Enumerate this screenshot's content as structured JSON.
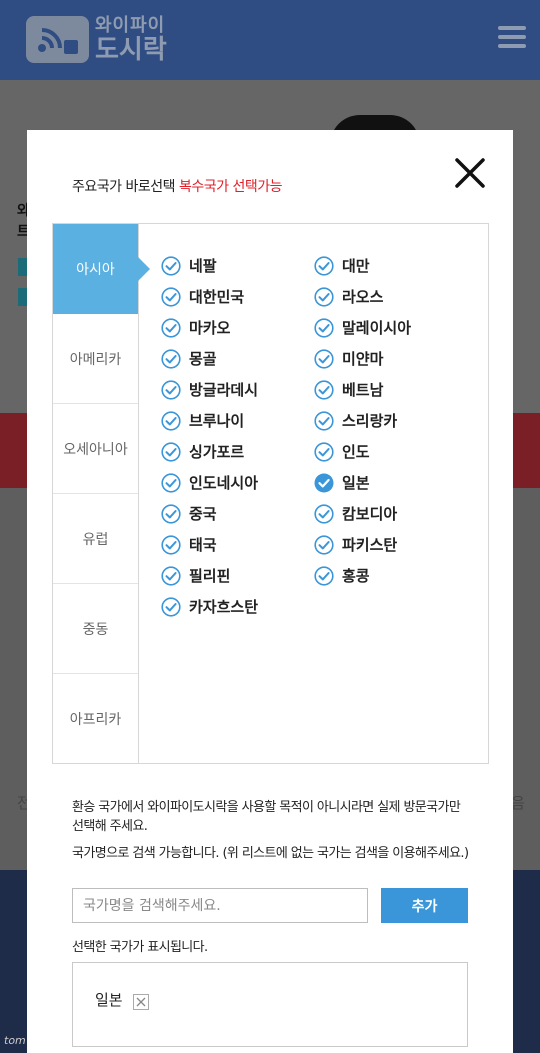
{
  "header": {
    "logo_line1": "와이파이",
    "logo_line2": "도시락"
  },
  "background": {
    "frag1": "와",
    "frag2": "트",
    "frag3": "전",
    "frag4": "음"
  },
  "watermark": "tom",
  "modal": {
    "title": "주요국가 바로선택",
    "title_note": "복수국가 선택가능",
    "tabs": [
      "아시아",
      "아메리카",
      "오세아니아",
      "유럽",
      "중동",
      "아프리카"
    ],
    "active_tab": "아시아",
    "countries": [
      {
        "name": "네팔",
        "checked": false
      },
      {
        "name": "대만",
        "checked": false
      },
      {
        "name": "대한민국",
        "checked": false
      },
      {
        "name": "라오스",
        "checked": false
      },
      {
        "name": "마카오",
        "checked": false
      },
      {
        "name": "말레이시아",
        "checked": false
      },
      {
        "name": "몽골",
        "checked": false
      },
      {
        "name": "미얀마",
        "checked": false
      },
      {
        "name": "방글라데시",
        "checked": false
      },
      {
        "name": "베트남",
        "checked": false
      },
      {
        "name": "브루나이",
        "checked": false
      },
      {
        "name": "스리랑카",
        "checked": false
      },
      {
        "name": "싱가포르",
        "checked": false
      },
      {
        "name": "인도",
        "checked": false
      },
      {
        "name": "인도네시아",
        "checked": false
      },
      {
        "name": "일본",
        "checked": true
      },
      {
        "name": "중국",
        "checked": false
      },
      {
        "name": "캄보디아",
        "checked": false
      },
      {
        "name": "태국",
        "checked": false
      },
      {
        "name": "파키스탄",
        "checked": false
      },
      {
        "name": "필리핀",
        "checked": false
      },
      {
        "name": "홍콩",
        "checked": false
      },
      {
        "name": "카자흐스탄",
        "checked": false
      }
    ],
    "note1": "환승 국가에서 와이파이도시락을 사용할 목적이 아니시라면 실제 방문국가만 선택해 주세요.",
    "note2": "국가명으로 검색 가능합니다. (위 리스트에 없는 국가는 검색을 이용해주세요.)",
    "search_placeholder": "국가명을 검색해주세요.",
    "search_value": "",
    "add_label": "추가",
    "selected_label": "선택한 국가가 표시됩니다.",
    "selected": [
      "일본"
    ]
  },
  "colors": {
    "accent": "#5ab0e0",
    "check": "#3a96d8",
    "multi": "#e0202a",
    "header": "#2f4d82"
  }
}
